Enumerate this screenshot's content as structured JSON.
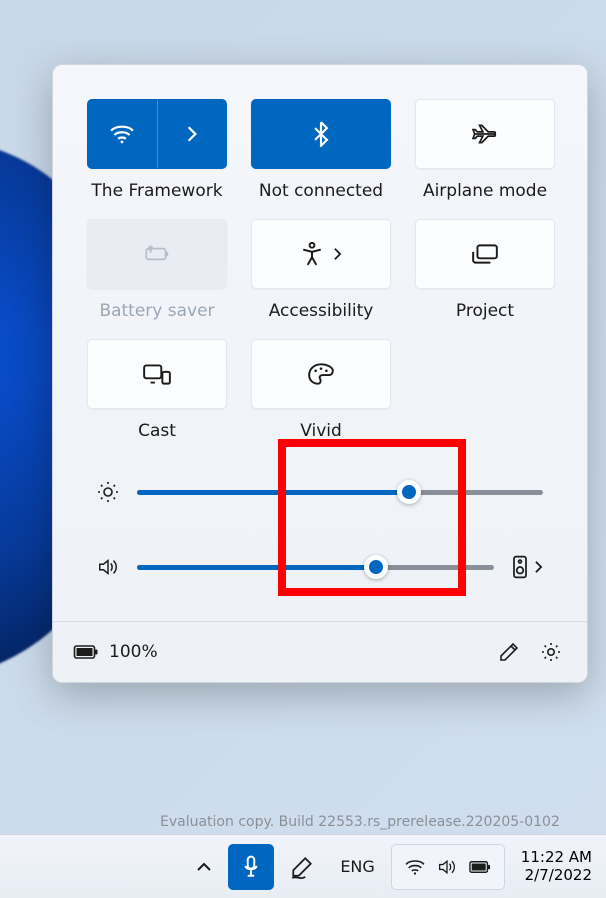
{
  "tiles": {
    "wifi": {
      "label": "The Framework"
    },
    "bluetooth": {
      "label": "Not connected"
    },
    "airplane": {
      "label": "Airplane mode"
    },
    "battery_saver": {
      "label": "Battery saver"
    },
    "accessibility": {
      "label": "Accessibility"
    },
    "project": {
      "label": "Project"
    },
    "cast": {
      "label": "Cast"
    },
    "vivid": {
      "label": "Vivid"
    }
  },
  "sliders": {
    "brightness": {
      "percent": 67
    },
    "volume": {
      "percent": 67
    }
  },
  "footer": {
    "battery_pct": "100%"
  },
  "watermark": "Evaluation copy. Build 22553.rs_prerelease.220205-0102",
  "taskbar": {
    "lang": "ENG",
    "time": "11:22 AM",
    "date": "2/7/2022"
  }
}
